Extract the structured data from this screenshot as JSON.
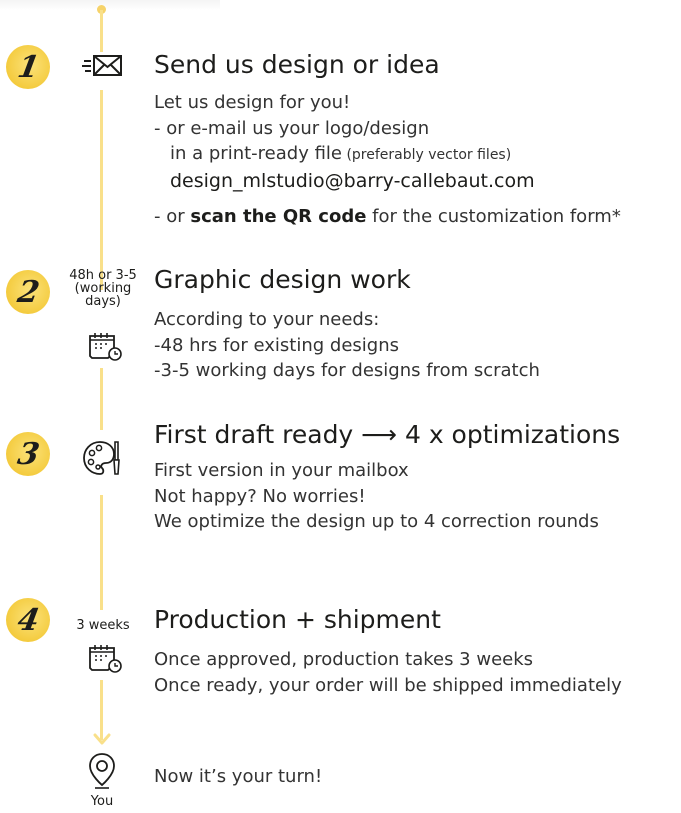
{
  "steps": [
    {
      "number": "1",
      "title": "Send us   design or idea",
      "lines": {
        "l1": "Let us design for you!",
        "l2": "- or e-mail us your logo/design",
        "l3a": "in a print-ready file",
        "l3b": " (preferably vector files)",
        "l4": "design_mlstudio@barry-callebaut.com",
        "l5a": "- or ",
        "l5b": "scan the QR code",
        "l5c": " for the customization form*"
      },
      "icon": "envelope-icon"
    },
    {
      "number": "2",
      "side_label_1": "48h or 3-5",
      "side_label_2": "(working",
      "side_label_3": "days)",
      "title": "Graphic design work",
      "lines": {
        "l1": "According to your needs:",
        "l2": "-48 hrs for existing designs",
        "l3": "-3-5 working days for designs from scratch"
      },
      "icon": "calendar-clock-icon"
    },
    {
      "number": "3",
      "title": "First draft ready ⟶ 4 x optimizations",
      "lines": {
        "l1": "First version in your mailbox",
        "l2": "Not happy? No worries!",
        "l3": "We optimize the design up to 4 correction rounds"
      },
      "icon": "palette-icon"
    },
    {
      "number": "4",
      "side_label": "3 weeks",
      "title": "Production + shipment",
      "lines": {
        "l1": "Once approved, production takes 3 weeks",
        "l2": "Once ready, your order will be shipped immediately"
      },
      "icon": "calendar-clock-icon"
    }
  ],
  "final": {
    "text": "Now it’s your turn!",
    "pin_label": "You",
    "icon": "location-pin-icon"
  },
  "colors": {
    "accent": "#f4cb3e",
    "line": "#f9e08a",
    "text": "#1d1d1b"
  }
}
